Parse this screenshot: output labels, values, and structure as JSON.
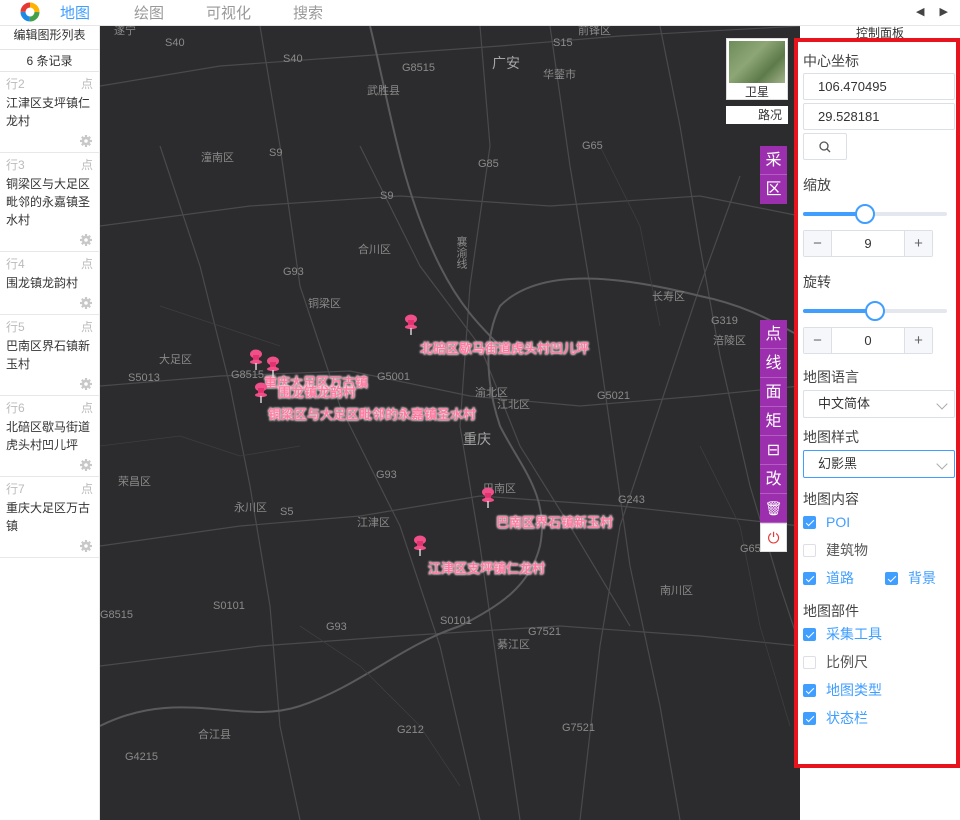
{
  "nav": {
    "items": [
      "地图",
      "绘图",
      "可视化",
      "搜索"
    ],
    "arrows": "◀ ▶"
  },
  "left_panel": {
    "title": "编辑图形列表",
    "count": "6 条记录",
    "records": [
      {
        "row": "行2",
        "type": "点",
        "name": "江津区支坪镇仁龙村"
      },
      {
        "row": "行3",
        "type": "点",
        "name": "铜梁区与大足区毗邻的永嘉镇圣水村"
      },
      {
        "row": "行4",
        "type": "点",
        "name": "围龙镇龙韵村"
      },
      {
        "row": "行5",
        "type": "点",
        "name": "巴南区界石镇新玉村"
      },
      {
        "row": "行6",
        "type": "点",
        "name": "北碚区歇马街道虎头村凹儿坪"
      },
      {
        "row": "行7",
        "type": "点",
        "name": "重庆大足区万古镇"
      }
    ]
  },
  "map": {
    "place_labels": [
      "遂宁",
      "S40",
      "S40",
      "G8515",
      "广安",
      "S15",
      "华蓥市",
      "武胜县",
      "前锋区",
      "潼南区",
      "S9",
      "G85",
      "G65",
      "S9",
      "合川区",
      "G93",
      "铜梁区",
      "长寿区",
      "G319",
      "涪陵区",
      "大足区",
      "S5013",
      "G8515",
      "G5001",
      "渝北区",
      "江北区",
      "G5021",
      "重庆",
      "荣昌区",
      "G93",
      "巴南区",
      "G243",
      "永川区",
      "S5",
      "江津区",
      "G65",
      "南川区",
      "G8515",
      "S0101",
      "G93",
      "S0101",
      "G7521",
      "綦江区",
      "合江县",
      "G212",
      "G7521",
      "G4215",
      "襄渝线"
    ],
    "pins": [
      "北碚区歇马街道虎头村凹儿坪",
      "重庆大足区万古镇",
      "围龙镇龙韵村",
      "铜梁区与大足区毗邻的永嘉镇圣水村",
      "巴南区界石镇新玉村",
      "江津区支坪镇仁龙村"
    ],
    "maptype": {
      "satellite": "卫星",
      "road": "路况"
    },
    "collect_tool": [
      "采",
      "区"
    ],
    "draw_tools": [
      "点",
      "线",
      "面",
      "矩",
      "⊟",
      "改",
      "🗑"
    ],
    "power": "⏻"
  },
  "control": {
    "header": "控制面板",
    "center_label": "中心坐标",
    "lng": "106.470495",
    "lat": "29.528181",
    "zoom_label": "缩放",
    "zoom_value": "9",
    "zoom_fraction": 0.43,
    "rotate_label": "旋转",
    "rotate_value": "0",
    "rotate_fraction": 0.5,
    "lang_label": "地图语言",
    "lang_value": "中文简体",
    "style_label": "地图样式",
    "style_value": "幻影黑",
    "content_label": "地图内容",
    "content": {
      "poi": "POI",
      "building": "建筑物",
      "road": "道路",
      "background": "背景"
    },
    "parts_label": "地图部件",
    "parts": {
      "collect": "采集工具",
      "scale": "比例尺",
      "maptype": "地图类型",
      "status": "状态栏"
    },
    "minus": "−",
    "plus": "+"
  }
}
